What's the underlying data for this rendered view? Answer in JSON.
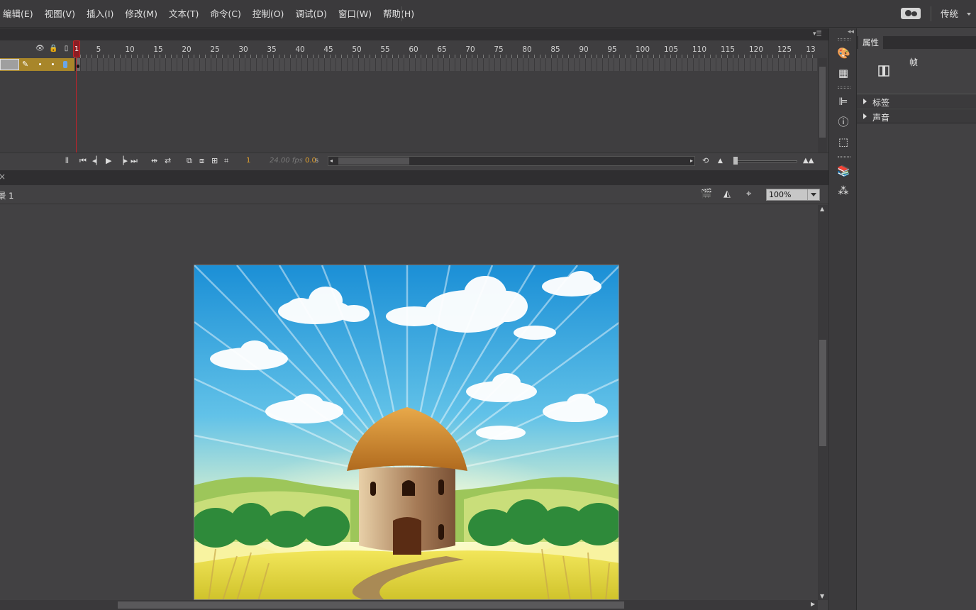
{
  "menubar": {
    "items": [
      "编辑(E)",
      "视图(V)",
      "插入(I)",
      "修改(M)",
      "文本(T)",
      "命令(C)",
      "控制(O)",
      "调试(D)",
      "窗口(W)",
      "帮助(H)"
    ],
    "workspace": "传统"
  },
  "timeline": {
    "ruler_labels": [
      "1",
      "5",
      "10",
      "15",
      "20",
      "25",
      "30",
      "35",
      "40",
      "45",
      "50",
      "55",
      "60",
      "65",
      "70",
      "75",
      "80",
      "85",
      "90",
      "95",
      "100",
      "105",
      "110",
      "115",
      "120",
      "125",
      "13"
    ],
    "current_frame": "1",
    "fps": "24.00 fps",
    "seconds": "0.0",
    "seconds_unit": "s"
  },
  "document": {
    "scene_label": "景 1",
    "zoom": "100%"
  },
  "properties": {
    "tab_label": "属性",
    "frame_label": "帧",
    "sections": [
      "标签",
      "声音"
    ]
  },
  "colors": {
    "ui_background": "#424143",
    "layer_highlight": "#a8862a",
    "playhead": "#c0222b",
    "frame_info": "#e0a030"
  },
  "icons": [
    "eye-icon",
    "lock-icon",
    "outline-icon",
    "pencil-icon",
    "swatches-icon",
    "align-icon",
    "info-icon",
    "transform-icon",
    "library-icon",
    "motion-presets-icon"
  ]
}
